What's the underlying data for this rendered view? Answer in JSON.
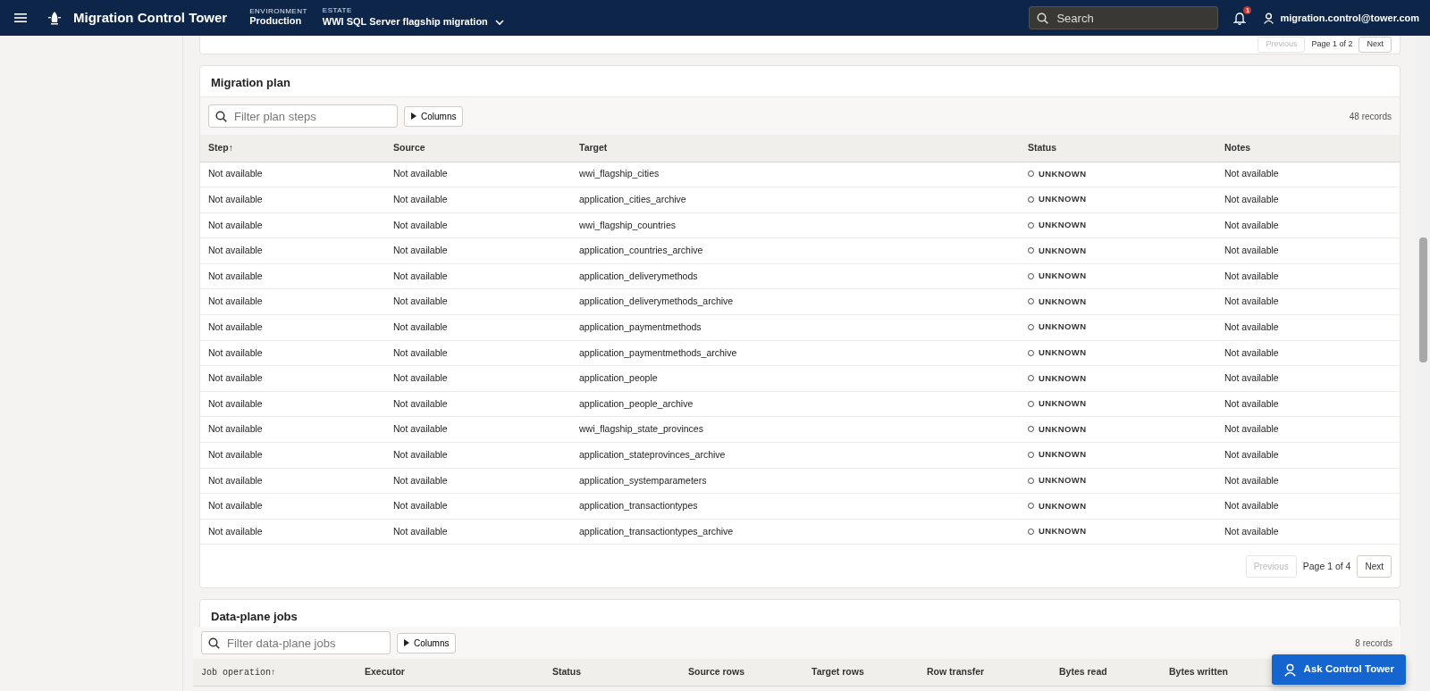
{
  "header": {
    "app_title": "Migration Control Tower",
    "environment_label": "ENVIRONMENT",
    "environment": "Production",
    "estate_label": "ESTATE",
    "estate": "WWI SQL Server flagship migration",
    "search_placeholder": "Search",
    "notification_count": "1",
    "user": "migration.control@tower.com"
  },
  "previous_table": {
    "pagination": {
      "previous": {
        "label": "Previous",
        "disabled": true
      },
      "page": "Page 1 of 2",
      "next": {
        "label": "Next",
        "disabled": false
      }
    }
  },
  "migration_plan": {
    "title": "Migration plan",
    "filter_placeholder": "Filter plan steps",
    "columns_button": "Columns",
    "record_count": "48 records",
    "columns": [
      "Step↑",
      "Source",
      "Target",
      "Status",
      "Notes"
    ],
    "rows": [
      {
        "step": "Not available",
        "source": "Not available",
        "target": "wwi_flagship_cities",
        "status": "UNKNOWN",
        "notes": "Not available"
      },
      {
        "step": "Not available",
        "source": "Not available",
        "target": "application_cities_archive",
        "status": "UNKNOWN",
        "notes": "Not available"
      },
      {
        "step": "Not available",
        "source": "Not available",
        "target": "wwi_flagship_countries",
        "status": "UNKNOWN",
        "notes": "Not available"
      },
      {
        "step": "Not available",
        "source": "Not available",
        "target": "application_countries_archive",
        "status": "UNKNOWN",
        "notes": "Not available"
      },
      {
        "step": "Not available",
        "source": "Not available",
        "target": "application_deliverymethods",
        "status": "UNKNOWN",
        "notes": "Not available"
      },
      {
        "step": "Not available",
        "source": "Not available",
        "target": "application_deliverymethods_archive",
        "status": "UNKNOWN",
        "notes": "Not available"
      },
      {
        "step": "Not available",
        "source": "Not available",
        "target": "application_paymentmethods",
        "status": "UNKNOWN",
        "notes": "Not available"
      },
      {
        "step": "Not available",
        "source": "Not available",
        "target": "application_paymentmethods_archive",
        "status": "UNKNOWN",
        "notes": "Not available"
      },
      {
        "step": "Not available",
        "source": "Not available",
        "target": "application_people",
        "status": "UNKNOWN",
        "notes": "Not available"
      },
      {
        "step": "Not available",
        "source": "Not available",
        "target": "application_people_archive",
        "status": "UNKNOWN",
        "notes": "Not available"
      },
      {
        "step": "Not available",
        "source": "Not available",
        "target": "wwi_flagship_state_provinces",
        "status": "UNKNOWN",
        "notes": "Not available"
      },
      {
        "step": "Not available",
        "source": "Not available",
        "target": "application_stateprovinces_archive",
        "status": "UNKNOWN",
        "notes": "Not available"
      },
      {
        "step": "Not available",
        "source": "Not available",
        "target": "application_systemparameters",
        "status": "UNKNOWN",
        "notes": "Not available"
      },
      {
        "step": "Not available",
        "source": "Not available",
        "target": "application_transactiontypes",
        "status": "UNKNOWN",
        "notes": "Not available"
      },
      {
        "step": "Not available",
        "source": "Not available",
        "target": "application_transactiontypes_archive",
        "status": "UNKNOWN",
        "notes": "Not available"
      }
    ],
    "pagination": {
      "previous": {
        "label": "Previous",
        "disabled": true
      },
      "page": "Page 1 of 4",
      "next": {
        "label": "Next",
        "disabled": false
      }
    }
  },
  "data_plane_jobs": {
    "title": "Data-plane jobs",
    "filter_placeholder": "Filter data-plane jobs",
    "columns_button": "Columns",
    "record_count": "8 records",
    "columns": [
      "Job operation↑",
      "Executor",
      "Status",
      "Source rows",
      "Target rows",
      "Row transfer",
      "Bytes read",
      "Bytes written"
    ]
  },
  "assistant_button": "Ask Control Tower"
}
